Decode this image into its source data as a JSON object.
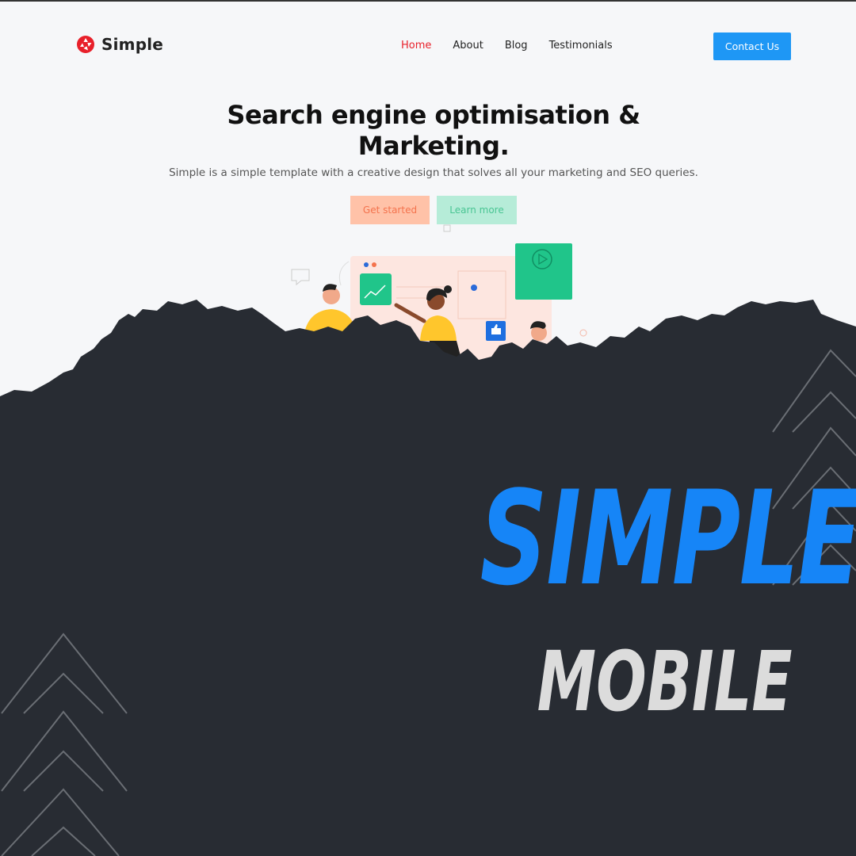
{
  "brand": {
    "name": "Simple",
    "logo_icon": "shutter-logo-icon",
    "accent": "#e8202a"
  },
  "nav": {
    "items": [
      {
        "label": "Home",
        "active": true
      },
      {
        "label": "About",
        "active": false
      },
      {
        "label": "Blog",
        "active": false
      },
      {
        "label": "Testimonials",
        "active": false
      }
    ],
    "cta_label": "Contact Us",
    "cta_color": "#1e97f5"
  },
  "hero": {
    "title_line1": "Search engine optimisation &",
    "title_line2": "Marketing.",
    "subtitle": "Simple is a simple template with a creative design that solves all your marketing and SEO queries.",
    "primary_button": "Get started",
    "secondary_button": "Learn more"
  },
  "promo": {
    "headline": "SIMPLE",
    "subheadline": "MOBILE",
    "headline_color": "#1685f7",
    "background": "#282c33"
  }
}
